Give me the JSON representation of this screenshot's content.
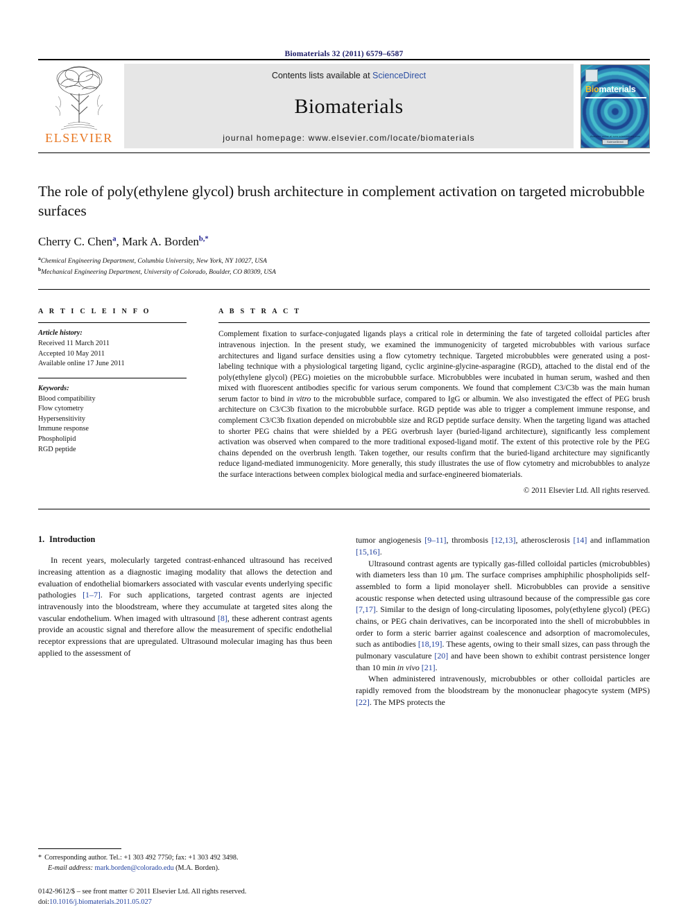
{
  "running_head": "Biomaterials 32 (2011) 6579–6587",
  "masthead": {
    "publisher_name": "ELSEVIER",
    "contents_prefix": "Contents lists available at ",
    "contents_link": "ScienceDirect",
    "journal_name": "Biomaterials",
    "homepage": "journal homepage: www.elsevier.com/locate/biomaterials",
    "cover": {
      "title_part1": "Bio",
      "title_part2": "materials",
      "footer_text": "Available online at www.sciencedirect.com",
      "badge_text": "ScienceDirect"
    },
    "link_color": "#2b4ea2"
  },
  "article": {
    "title": "The role of poly(ethylene glycol) brush architecture in complement activation on targeted microbubble surfaces",
    "authors": [
      {
        "name": "Cherry C. Chen",
        "marker": "a"
      },
      {
        "name": "Mark A. Borden",
        "marker": "b,*"
      }
    ],
    "affiliations": [
      {
        "marker": "a",
        "text": "Chemical Engineering Department, Columbia University, New York, NY 10027, USA"
      },
      {
        "marker": "b",
        "text": "Mechanical Engineering Department, University of Colorado, Boulder, CO 80309, USA"
      }
    ]
  },
  "article_info": {
    "heading": "A R T I C L E    I N F O",
    "history_label": "Article history:",
    "history": [
      "Received 11 March 2011",
      "Accepted 10 May 2011",
      "Available online 17 June 2011"
    ],
    "keywords_label": "Keywords:",
    "keywords": [
      "Blood compatibility",
      "Flow cytometry",
      "Hypersensitivity",
      "Immune response",
      "Phospholipid",
      "RGD peptide"
    ]
  },
  "abstract": {
    "heading": "A B S T R A C T",
    "text": "Complement fixation to surface-conjugated ligands plays a critical role in determining the fate of targeted colloidal particles after intravenous injection. In the present study, we examined the immunogenicity of targeted microbubbles with various surface architectures and ligand surface densities using a flow cytometry technique. Targeted microbubbles were generated using a post-labeling technique with a physiological targeting ligand, cyclic arginine-glycine-asparagine (RGD), attached to the distal end of the poly(ethylene glycol) (PEG) moieties on the microbubble surface. Microbubbles were incubated in human serum, washed and then mixed with fluorescent antibodies specific for various serum components. We found that complement C3/C3b was the main human serum factor to bind in vitro to the microbubble surface, compared to IgG or albumin. We also investigated the effect of PEG brush architecture on C3/C3b fixation to the microbubble surface. RGD peptide was able to trigger a complement immune response, and complement C3/C3b fixation depended on microbubble size and RGD peptide surface density. When the targeting ligand was attached to shorter PEG chains that were shielded by a PEG overbrush layer (buried-ligand architecture), significantly less complement activation was observed when compared to the more traditional exposed-ligand motif. The extent of this protective role by the PEG chains depended on the overbrush length. Taken together, our results confirm that the buried-ligand architecture may significantly reduce ligand-mediated immunogenicity. More generally, this study illustrates the use of flow cytometry and microbubbles to analyze the surface interactions between complex biological media and surface-engineered biomaterials.",
    "italic_phrase": "in vitro",
    "copyright": "© 2011 Elsevier Ltd. All rights reserved."
  },
  "body": {
    "section_number": "1.",
    "section_title": "Introduction",
    "left_paragraphs": [
      "In recent years, molecularly targeted contrast-enhanced ultrasound has received increasing attention as a diagnostic imaging modality that allows the detection and evaluation of endothelial biomarkers associated with vascular events underlying specific pathologies [1–7]. For such applications, targeted contrast agents are injected intravenously into the bloodstream, where they accumulate at targeted sites along the vascular endothelium. When imaged with ultrasound [8], these adherent contrast agents provide an acoustic signal and therefore allow the measurement of specific endothelial receptor expressions that are upregulated. Ultrasound molecular imaging has thus been applied to the assessment of"
    ],
    "right_paragraphs": [
      "tumor angiogenesis [9–11], thrombosis [12,13], atherosclerosis [14] and inflammation [15,16].",
      "Ultrasound contrast agents are typically gas-filled colloidal particles (microbubbles) with diameters less than 10 μm. The surface comprises amphiphilic phospholipids self-assembled to form a lipid monolayer shell. Microbubbles can provide a sensitive acoustic response when detected using ultrasound because of the compressible gas core [7,17]. Similar to the design of long-circulating liposomes, poly(ethylene glycol) (PEG) chains, or PEG chain derivatives, can be incorporated into the shell of microbubbles in order to form a steric barrier against coalescence and adsorption of macromolecules, such as antibodies [18,19]. These agents, owing to their small sizes, can pass through the pulmonary vasculature [20] and have been shown to exhibit contrast persistence longer than 10 min in vivo [21].",
      "When administered intravenously, microbubbles or other colloidal particles are rapidly removed from the bloodstream by the mononuclear phagocyte system (MPS) [22]. The MPS protects the"
    ]
  },
  "footnote": {
    "marker": "*",
    "corresponding": "Corresponding author. Tel.: +1 303 492 7750; fax: +1 303 492 3498.",
    "email_label": "E-mail address:",
    "email": "mark.borden@colorado.edu",
    "email_owner": "(M.A. Borden)."
  },
  "footer": {
    "line1": "0142-9612/$ – see front matter © 2011 Elsevier Ltd. All rights reserved.",
    "doi_label": "doi:",
    "doi": "10.1016/j.biomaterials.2011.05.027"
  }
}
